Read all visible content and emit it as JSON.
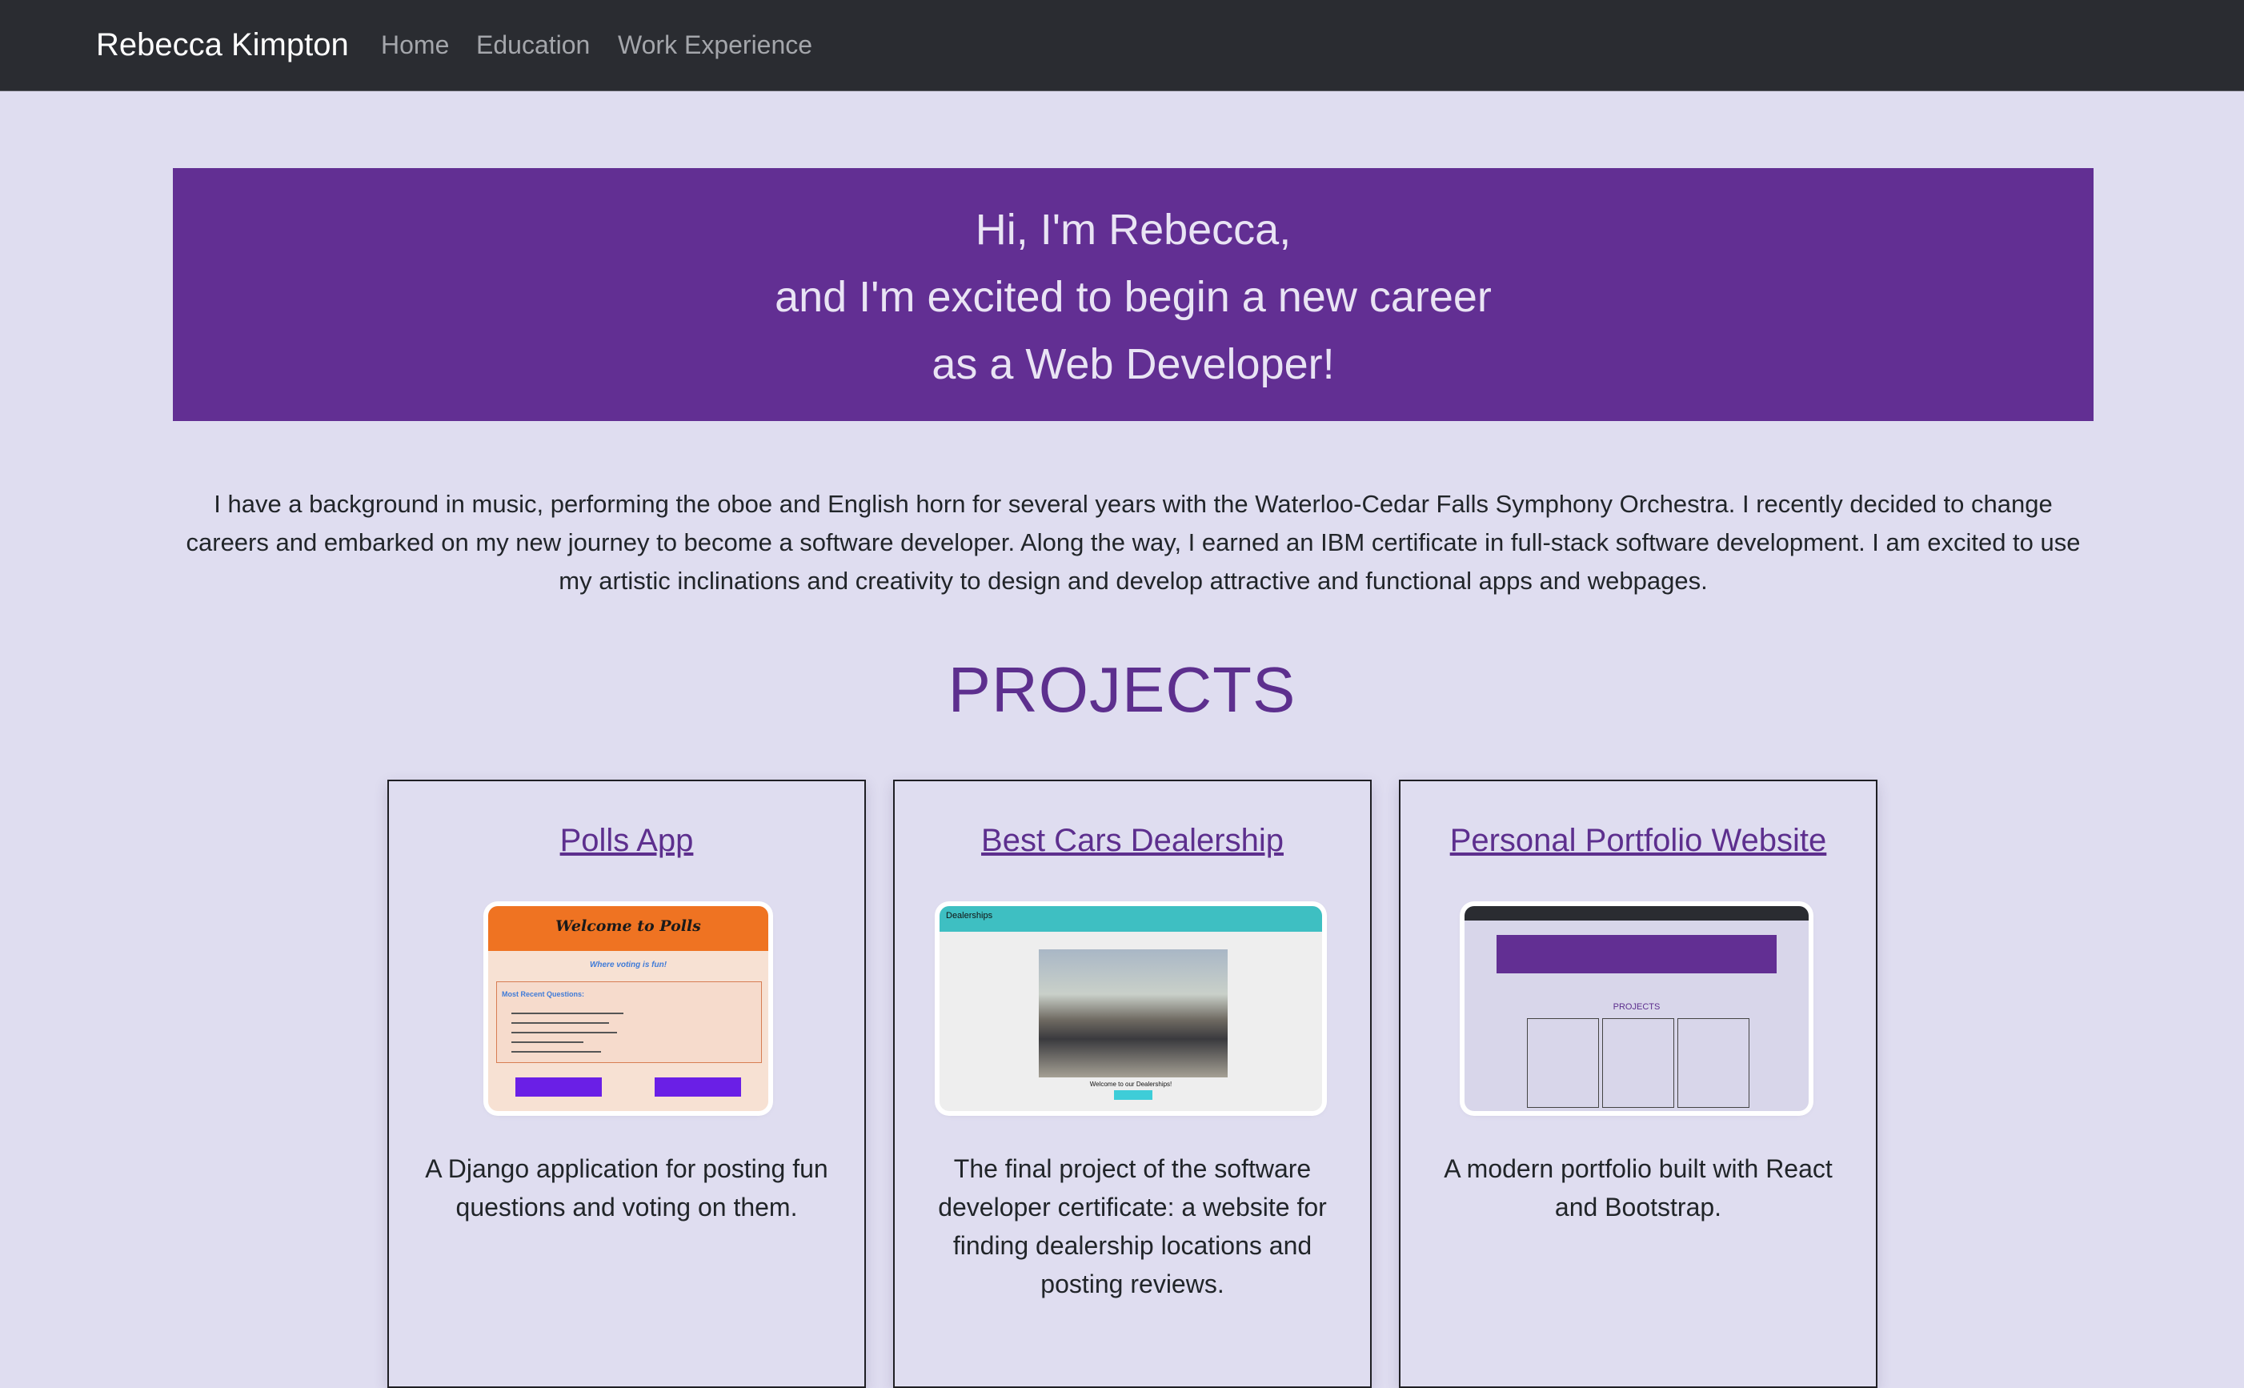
{
  "nav": {
    "brand": "Rebecca Kimpton",
    "links": [
      "Home",
      "Education",
      "Work Experience"
    ]
  },
  "hero": {
    "lines": [
      "Hi, I'm Rebecca,",
      "and I'm excited to begin a new career",
      "as a Web Developer!"
    ]
  },
  "intro": {
    "text": "I have a background in music, performing the oboe and English horn for several years with the Waterloo-Cedar Falls Symphony Orchestra. I recently decided to change careers and embarked on my new journey to become a software developer. Along the way, I earned an IBM certificate in full-stack software development. I am excited to use my artistic inclinations and creativity to design and develop attractive and functional apps and webpages."
  },
  "projects": {
    "heading": "PROJECTS",
    "cards": [
      {
        "title": "Polls App",
        "description": "A Django application for posting fun questions and voting on them.",
        "thumb": {
          "heading": "Welcome to Polls",
          "tagline": "Where voting is fun!",
          "section": "Most Recent Questions:"
        }
      },
      {
        "title": "Best Cars Dealership",
        "description": "The final project of the software developer certificate: a website for finding dealership locations and posting reviews.",
        "thumb": {
          "nav": "Dealerships",
          "caption": "Welcome to our Dealerships!"
        }
      },
      {
        "title": "Personal Portfolio Website",
        "description": "A modern portfolio built with React and Bootstrap.",
        "thumb": {
          "heading": "PROJECTS"
        }
      }
    ]
  },
  "colors": {
    "navbar": "#2a2c31",
    "page_bg": "#dfddf0",
    "accent_purple": "#622f93",
    "heading_purple": "#5d2f8e"
  }
}
